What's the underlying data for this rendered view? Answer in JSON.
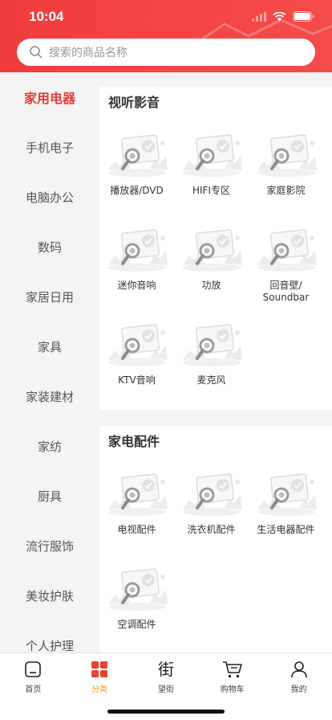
{
  "status": {
    "time": "10:04"
  },
  "search": {
    "placeholder": "搜索的商品名称"
  },
  "sidebar": {
    "categories": [
      "家用电器",
      "手机电子",
      "电脑办公",
      "数码",
      "家居日用",
      "家具",
      "家装建材",
      "家纺",
      "厨具",
      "流行服饰",
      "美妆护肤",
      "个人护理"
    ],
    "active_index": 0
  },
  "sections": [
    {
      "title": "视听影音",
      "items": [
        "播放器/DVD",
        "HIFI专区",
        "家庭影院",
        "迷你音响",
        "功放",
        "回音壁/\nSoundbar",
        "KTV音响",
        "麦克风"
      ]
    },
    {
      "title": "家电配件",
      "items": [
        "电视配件",
        "洗衣机配件",
        "生活电器配件",
        "空调配件"
      ]
    }
  ],
  "tabbar": {
    "items": [
      {
        "label": "首页",
        "icon": "home-icon"
      },
      {
        "label": "分类",
        "icon": "category-grid-icon"
      },
      {
        "label": "望街",
        "icon": "street-icon",
        "glyph": "街"
      },
      {
        "label": "购物车",
        "icon": "cart-icon"
      },
      {
        "label": "我的",
        "icon": "profile-icon"
      }
    ],
    "active_index": 1
  },
  "colors": {
    "brand_red": "#f23c3c",
    "active_tab": "#f0a020",
    "placeholder": "#999999"
  }
}
